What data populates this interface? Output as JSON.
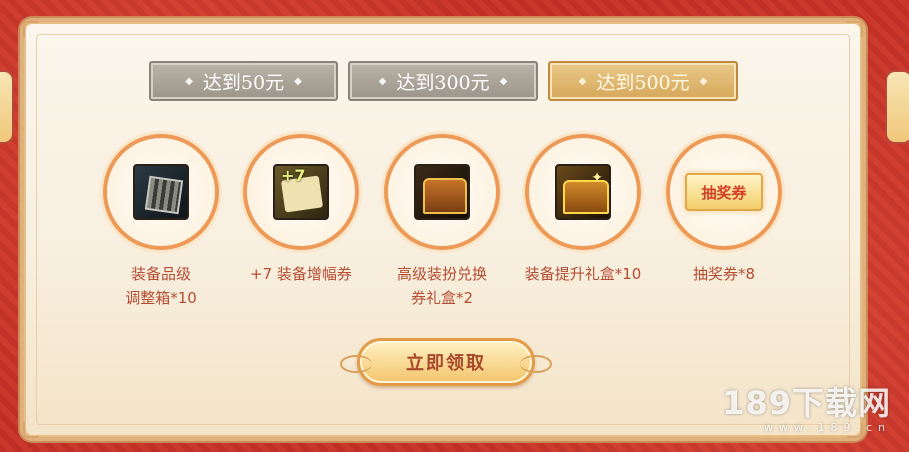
{
  "tabs": [
    {
      "label": "达到50元",
      "active": false
    },
    {
      "label": "达到300元",
      "active": false
    },
    {
      "label": "达到500元",
      "active": true
    }
  ],
  "rewards": [
    {
      "icon": "equipment-grade-box-icon",
      "caption_line1": "装备品级",
      "caption_line2": "调整箱*10"
    },
    {
      "icon": "amplify-scroll-icon",
      "icon_text": "+7",
      "caption_line1": "+7 装备增幅券",
      "caption_line2": ""
    },
    {
      "icon": "treasure-chest-icon",
      "caption_line1": "高级装扮兑换",
      "caption_line2": "券礼盒*2"
    },
    {
      "icon": "gift-chest-icon",
      "caption_line1": "装备提升礼盒*10",
      "caption_line2": ""
    },
    {
      "icon": "lottery-ticket-icon",
      "icon_text": "抽奖券",
      "caption_line1": "抽奖券*8",
      "caption_line2": ""
    }
  ],
  "claim_button": {
    "label": "立即领取"
  },
  "watermark": {
    "title": "189下载网",
    "url": "www.189.cn"
  },
  "colors": {
    "background": "#c9352a",
    "panel": "#fbf6ec",
    "accent_orange": "#ee9a57",
    "caption_text": "#b54d33",
    "tab_active": "#d6a85a",
    "tab_inactive": "#9c958a"
  }
}
